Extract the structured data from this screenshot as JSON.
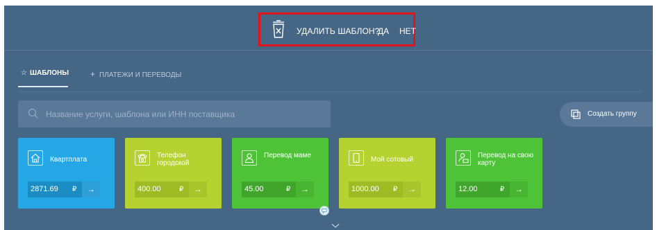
{
  "confirm": {
    "text": "УДАЛИТЬ ШАБЛОН?",
    "yes": "ДА",
    "no": "НЕТ"
  },
  "tabs": [
    {
      "label": "ШАБЛОНЫ",
      "icon": "star-icon",
      "active": true
    },
    {
      "label": "ПЛАТЕЖИ И ПЕРЕВОДЫ",
      "icon": "plus-icon",
      "active": false
    }
  ],
  "search": {
    "placeholder": "Название услуги, шаблона или ИНН поставщика",
    "value": ""
  },
  "create_group": {
    "label": "Создать группу",
    "icon": "copy-icon"
  },
  "cards": [
    {
      "title": "Квартплата",
      "icon": "house-icon",
      "amount": "2871.69",
      "currency": "₽",
      "color": "#25a7e5"
    },
    {
      "title": "Телефон городской",
      "icon": "phone-icon",
      "amount": "400.00",
      "currency": "₽",
      "color": "#b5d231"
    },
    {
      "title": "Перевод маме",
      "icon": "person-icon",
      "amount": "45.00",
      "currency": "₽",
      "color": "#4fc338"
    },
    {
      "title": "Мой сотовый",
      "icon": "mobile-icon",
      "amount": "1000.00",
      "currency": "₽",
      "color": "#b5d231"
    },
    {
      "title": "Перевод на свою карту",
      "icon": "person-card-icon",
      "amount": "12.00",
      "currency": "₽",
      "color": "#4fc338"
    }
  ],
  "colors": {
    "background": "#466685",
    "highlight_border": "#e1141c"
  }
}
